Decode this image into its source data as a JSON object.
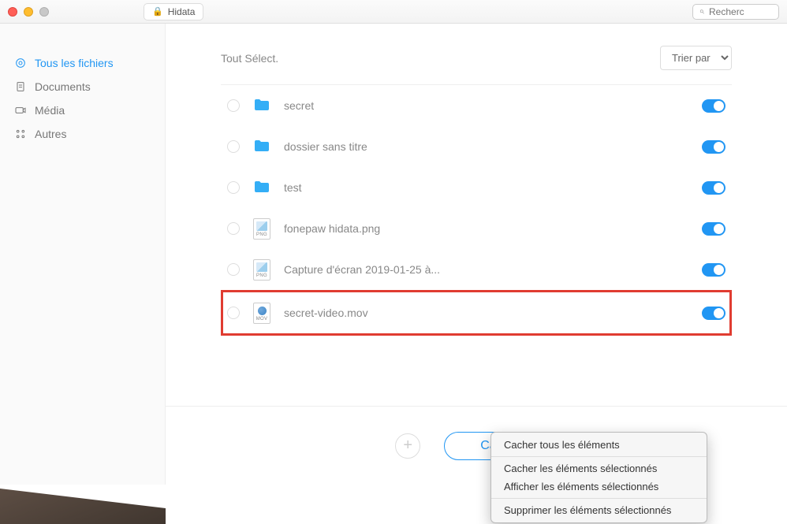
{
  "titlebar": {
    "app_name": "Hidata",
    "search_placeholder": "Recherc"
  },
  "sidebar": {
    "items": [
      {
        "label": "Tous les fichiers",
        "icon": "target"
      },
      {
        "label": "Documents",
        "icon": "document"
      },
      {
        "label": "Média",
        "icon": "camera"
      },
      {
        "label": "Autres",
        "icon": "grid"
      }
    ],
    "active_index": 0
  },
  "list_header": {
    "select_all": "Tout Sélect.",
    "sort_label": "Trier par"
  },
  "files": [
    {
      "name": "secret",
      "type": "folder",
      "toggle": true,
      "highlighted": false
    },
    {
      "name": "dossier sans titre",
      "type": "folder",
      "toggle": true,
      "highlighted": false
    },
    {
      "name": "test",
      "type": "folder",
      "toggle": true,
      "highlighted": false
    },
    {
      "name": "fonepaw hidata.png",
      "type": "png",
      "toggle": true,
      "highlighted": false
    },
    {
      "name": "Capture d'écran 2019-01-25 à...",
      "type": "png",
      "toggle": true,
      "highlighted": false
    },
    {
      "name": "secret-video.mov",
      "type": "mov",
      "toggle": true,
      "highlighted": true
    }
  ],
  "actions": {
    "hide_button": "Cacher"
  },
  "context_menu": {
    "items": [
      "Cacher tous les éléments",
      "Cacher les éléments sélectionnés",
      "Afficher les éléments sélectionnés",
      "Supprimer les éléments sélectionnés"
    ]
  }
}
